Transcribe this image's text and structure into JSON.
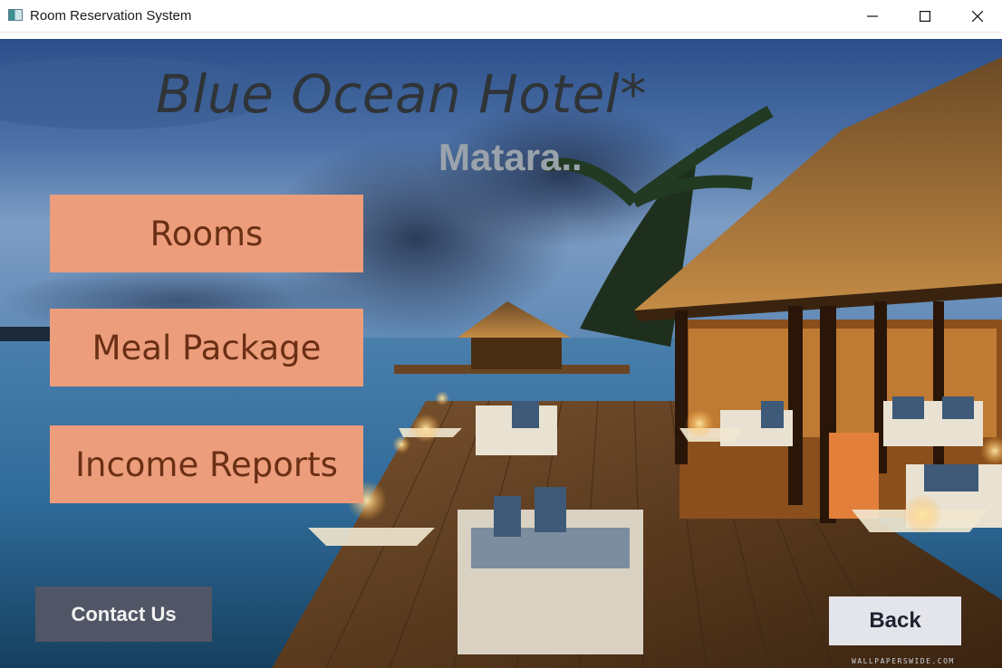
{
  "window": {
    "title": "Room Reservation System",
    "icons": [
      "app-icon",
      "minimize-icon",
      "maximize-icon",
      "close-icon"
    ]
  },
  "header": {
    "hotel_name": "Blue Ocean Hotel*",
    "location": "Matara.."
  },
  "menu": {
    "rooms_label": "Rooms",
    "meal_package_label": "Meal Package",
    "income_reports_label": "Income Reports"
  },
  "footer": {
    "contact_label": "Contact Us",
    "back_label": "Back",
    "watermark": "WALLPAPERSWIDE.COM"
  },
  "colors": {
    "menu_button": "#ec9d7c",
    "menu_text": "#6a2f14",
    "contact_button": "#505665",
    "back_button": "#e4e5ea"
  }
}
